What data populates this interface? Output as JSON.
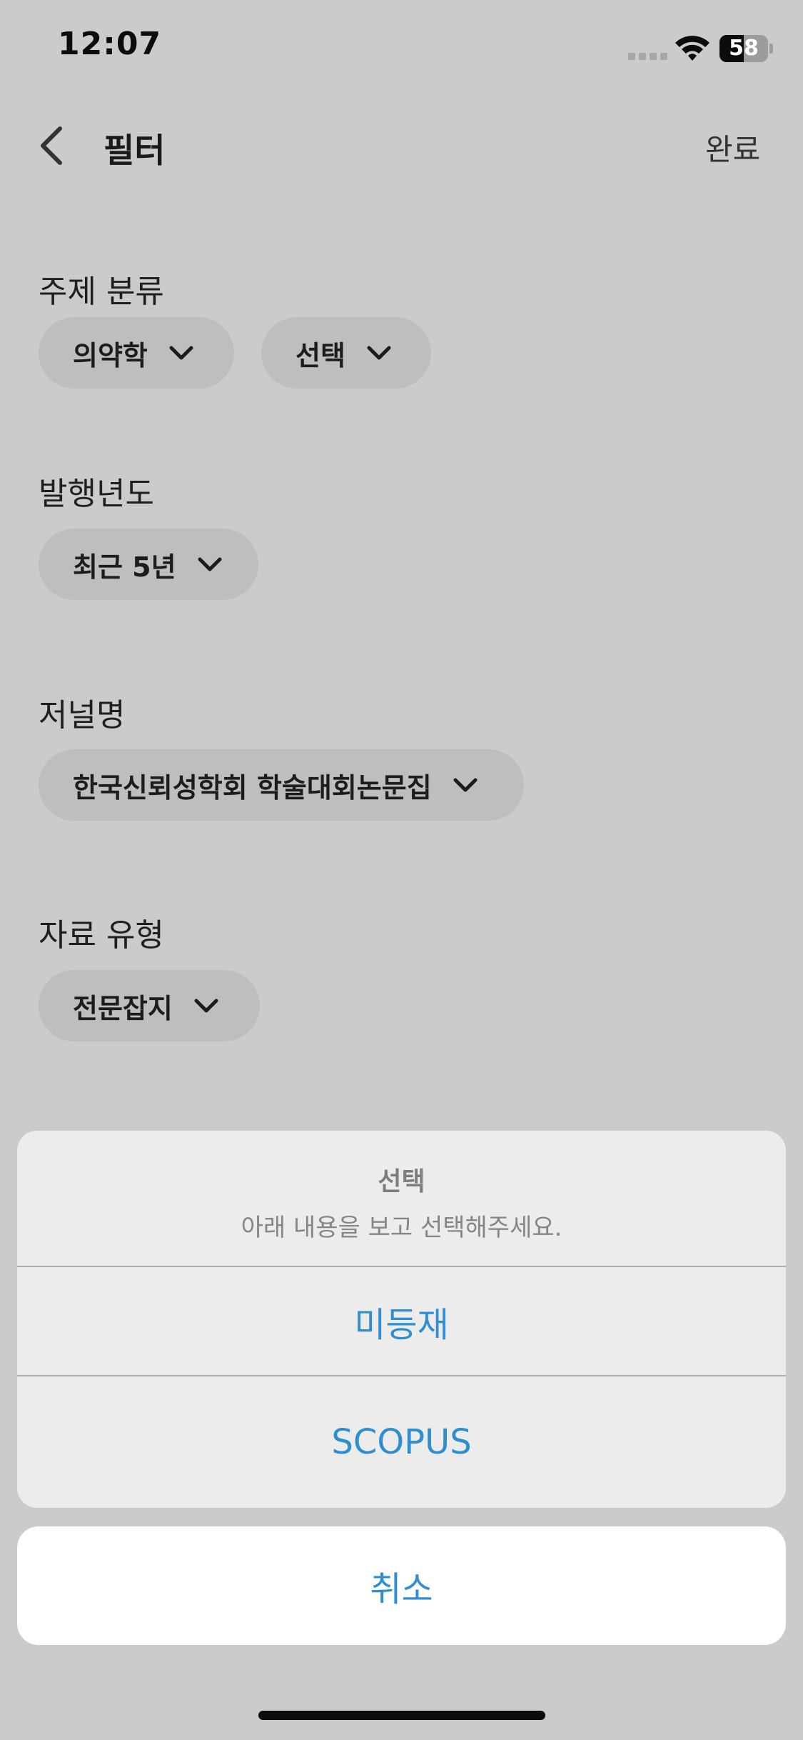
{
  "status_bar": {
    "time": "12:07",
    "battery": "58"
  },
  "header": {
    "title": "필터",
    "done_label": "완료"
  },
  "filters": {
    "subject": {
      "label": "주제 분류",
      "chip1": "의약학",
      "chip2": "선택"
    },
    "year": {
      "label": "발행년도",
      "chip": "최근 5년"
    },
    "journal": {
      "label": "저널명",
      "chip": "한국신뢰성학회 학술대회논문집"
    },
    "doc_type": {
      "label": "자료 유형",
      "chip": "전문잡지"
    }
  },
  "action_sheet": {
    "title": "선택",
    "message": "아래 내용을 보고 선택해주세요.",
    "options": [
      "미등재",
      "SCOPUS"
    ],
    "cancel_label": "취소"
  },
  "colors": {
    "background": "#cbcbcb",
    "chip": "#bebebe",
    "accent": "#2f8ecf",
    "sheet": "#ececec"
  }
}
